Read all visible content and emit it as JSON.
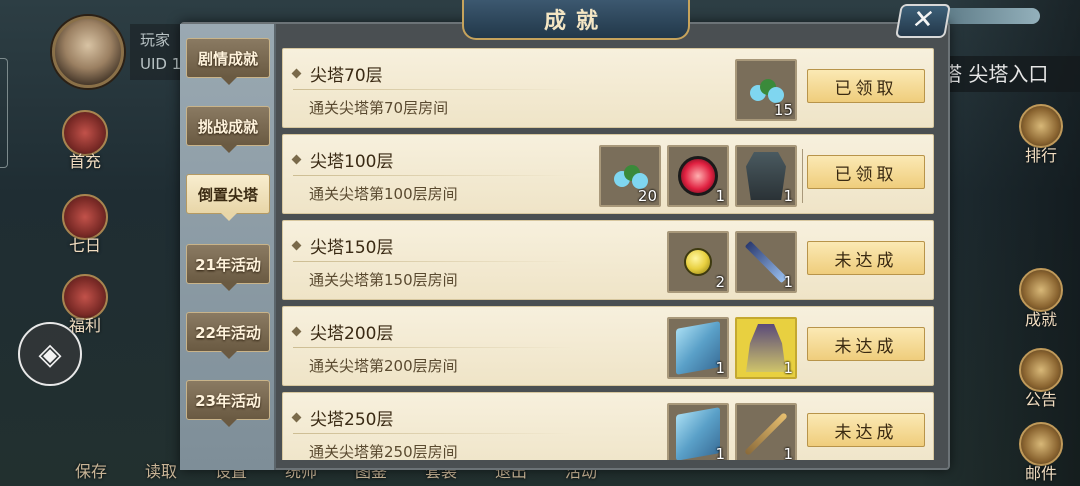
{
  "player": {
    "name": "玩家",
    "uid": "UID 1"
  },
  "left_buttons": [
    {
      "label": "首充",
      "icon": "first-recharge-icon"
    },
    {
      "label": "七日",
      "icon": "seven-day-icon"
    },
    {
      "label": "福利",
      "icon": "welfare-icon"
    }
  ],
  "bottom_bar": [
    "保存",
    "读取",
    "设置",
    "统帅",
    "图鉴",
    "套装",
    "退出",
    "活动"
  ],
  "right_panel": {
    "entrance": "塔 尖塔入口",
    "buttons": [
      {
        "label": "排行",
        "icon": "ranking-icon"
      },
      {
        "label": "成就",
        "icon": "achievement-icon"
      },
      {
        "label": "公告",
        "icon": "notice-icon"
      },
      {
        "label": "邮件",
        "icon": "mail-icon"
      }
    ]
  },
  "panel": {
    "title": "成就",
    "close_icon": "close-icon"
  },
  "tabs": [
    {
      "label": "剧情成就",
      "active": false
    },
    {
      "label": "挑战成就",
      "active": false
    },
    {
      "label": "倒置尖塔",
      "active": true
    },
    {
      "label": "21年活动",
      "active": false
    },
    {
      "label": "22年活动",
      "active": false
    },
    {
      "label": "23年活动",
      "active": false
    }
  ],
  "achievements": [
    {
      "title": "尖塔70层",
      "desc": "通关尖塔第70层房间",
      "rewards": [
        {
          "item": "jade-cloud",
          "count": "15"
        }
      ],
      "status": "已领取"
    },
    {
      "title": "尖塔100层",
      "desc": "通关尖塔第100层房间",
      "rewards": [
        {
          "item": "jade-cloud",
          "count": "20"
        },
        {
          "item": "red-clock",
          "count": "1"
        },
        {
          "item": "dark-armor",
          "count": "1"
        }
      ],
      "status": "已领取"
    },
    {
      "title": "尖塔150层",
      "desc": "通关尖塔第150层房间",
      "rewards": [
        {
          "item": "gold-coin",
          "count": "2"
        },
        {
          "item": "blue-blade",
          "count": "1"
        }
      ],
      "status": "未达成"
    },
    {
      "title": "尖塔200层",
      "desc": "通关尖塔第200层房间",
      "rewards": [
        {
          "item": "blue-book",
          "count": "1"
        },
        {
          "item": "warrior-figure",
          "count": "1"
        }
      ],
      "status": "未达成"
    },
    {
      "title": "尖塔250层",
      "desc": "通关尖塔第250层房间",
      "rewards": [
        {
          "item": "blue-book",
          "count": "1"
        },
        {
          "item": "golden-spear",
          "count": "1"
        }
      ],
      "status": "未达成"
    }
  ]
}
